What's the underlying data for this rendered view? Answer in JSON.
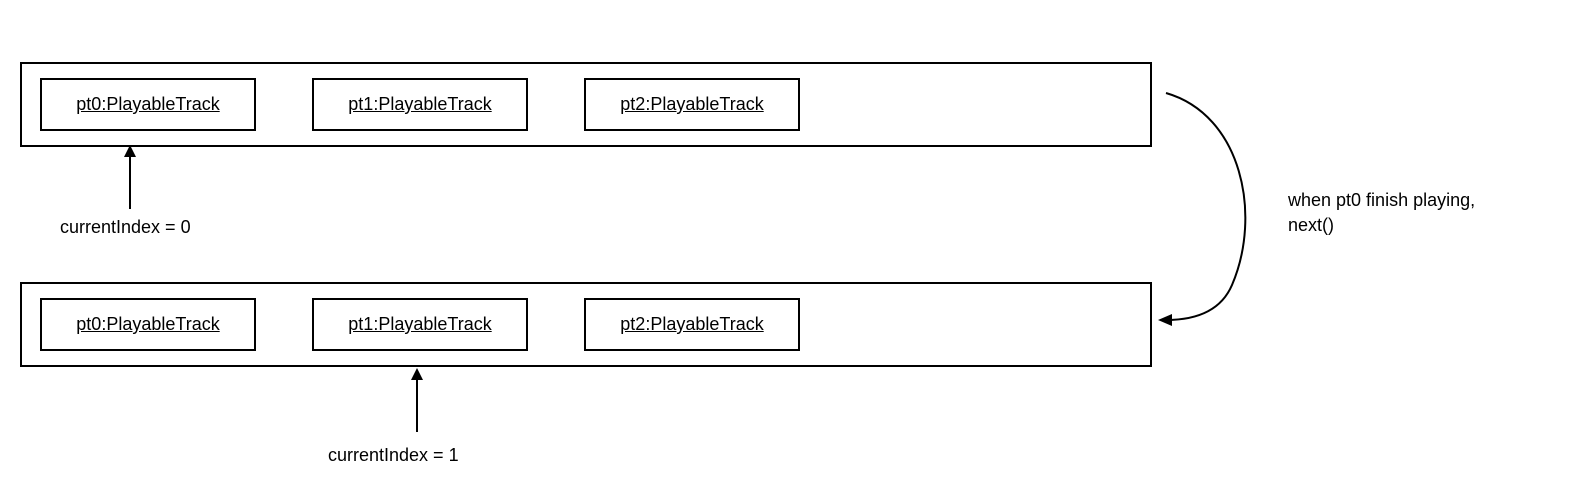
{
  "playlists": {
    "top": {
      "tracks": [
        "pt0:PlayableTrack",
        "pt1:PlayableTrack",
        "pt2:PlayableTrack"
      ]
    },
    "bottom": {
      "tracks": [
        "pt0:PlayableTrack",
        "pt1:PlayableTrack",
        "pt2:PlayableTrack"
      ]
    }
  },
  "indexLabels": {
    "top": "currentIndex = 0",
    "bottom": "currentIndex = 1"
  },
  "sideNote": {
    "line1": "when pt0 finish playing,",
    "line2": "next()"
  }
}
